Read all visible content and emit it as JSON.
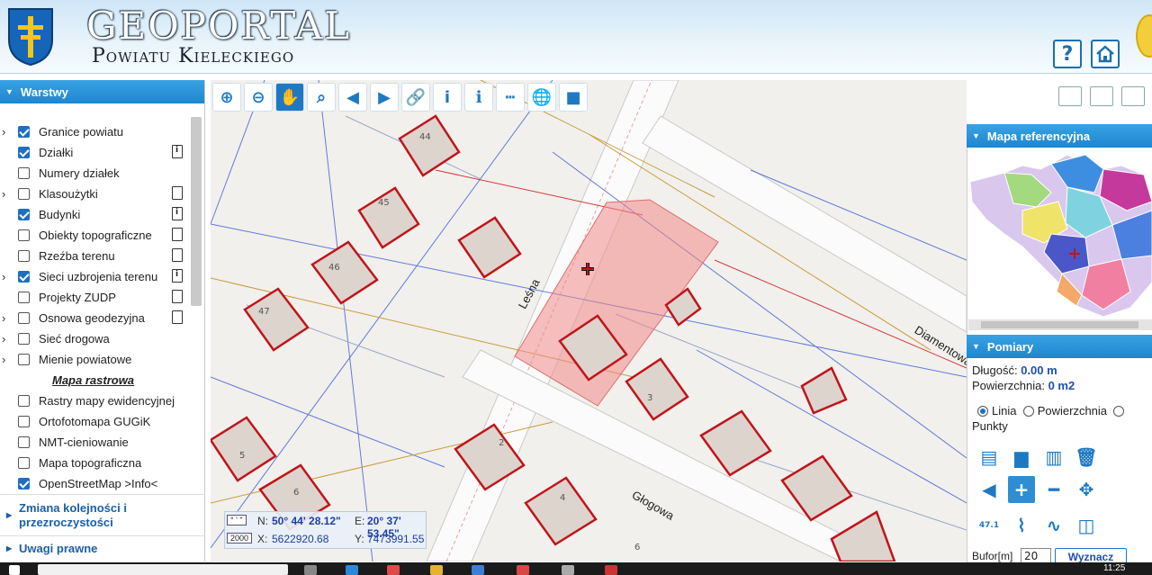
{
  "header": {
    "title": "Geoportal",
    "subtitle": "Powiatu Kieleckiego",
    "help_label": "?",
    "home_label": "⌂"
  },
  "left_panel": {
    "title": "Warstwy",
    "layers": [
      {
        "label": "Granice powiatu",
        "checked": true,
        "expandable": true,
        "doc": "none"
      },
      {
        "label": "Działki",
        "checked": true,
        "expandable": false,
        "doc": "info"
      },
      {
        "label": "Numery działek",
        "checked": false,
        "expandable": false,
        "doc": "none"
      },
      {
        "label": "Klasoużytki",
        "checked": false,
        "expandable": true,
        "doc": "plain"
      },
      {
        "label": "Budynki",
        "checked": true,
        "expandable": false,
        "doc": "info"
      },
      {
        "label": "Obiekty topograficzne",
        "checked": false,
        "expandable": false,
        "doc": "plain"
      },
      {
        "label": "Rzeźba terenu",
        "checked": false,
        "expandable": false,
        "doc": "plain"
      },
      {
        "label": "Sieci uzbrojenia terenu",
        "checked": true,
        "expandable": true,
        "doc": "info"
      },
      {
        "label": "Projekty ZUDP",
        "checked": false,
        "expandable": false,
        "doc": "plain"
      },
      {
        "label": "Osnowa geodezyjna",
        "checked": false,
        "expandable": true,
        "doc": "plain"
      },
      {
        "label": "Sieć drogowa",
        "checked": false,
        "expandable": true,
        "doc": "none"
      },
      {
        "label": "Mienie powiatowe",
        "checked": false,
        "expandable": true,
        "doc": "none"
      },
      {
        "label": "Mapa rastrowa",
        "group": true
      },
      {
        "label": "Rastry mapy ewidencyjnej",
        "checked": false,
        "expandable": false,
        "doc": "none"
      },
      {
        "label": "Ortofotomapa GUGiK",
        "checked": false,
        "expandable": false,
        "doc": "none"
      },
      {
        "label": "NMT-cieniowanie",
        "checked": false,
        "expandable": false,
        "doc": "none"
      },
      {
        "label": "Mapa topograficzna",
        "checked": false,
        "expandable": false,
        "doc": "none"
      },
      {
        "label": "OpenStreetMap >Info<",
        "checked": true,
        "expandable": false,
        "doc": "none"
      }
    ],
    "sections": {
      "order_line1": "Zmiana kolejności i",
      "order_line2": "przezroczystości",
      "legal": "Uwagi prawne"
    }
  },
  "toolbar": {
    "tools": [
      {
        "name": "zoom-in-tool",
        "glyph": "⊕",
        "active": false
      },
      {
        "name": "zoom-out-tool",
        "glyph": "⊖",
        "active": false
      },
      {
        "name": "pan-tool",
        "glyph": "✋",
        "active": true
      },
      {
        "name": "zoom-extent-tool",
        "glyph": "⌕",
        "active": false
      },
      {
        "name": "previous-view-tool",
        "glyph": "◀",
        "active": false
      },
      {
        "name": "next-view-tool",
        "glyph": "▶",
        "active": false
      },
      {
        "name": "link-tool",
        "glyph": "🔗",
        "active": false
      },
      {
        "name": "info-tool",
        "glyph": "i",
        "active": false
      },
      {
        "name": "info-advanced-tool",
        "glyph": "ℹ",
        "active": false
      },
      {
        "name": "measure-tool",
        "glyph": "┅",
        "active": false
      },
      {
        "name": "globe-tool",
        "glyph": "🌐",
        "active": false
      },
      {
        "name": "video-tool",
        "glyph": "■",
        "active": false
      }
    ]
  },
  "map": {
    "streets": [
      "Leśna",
      "Głogowa",
      "Diamentowa"
    ],
    "buildings": [
      {
        "num": "44"
      },
      {
        "num": "45"
      },
      {
        "num": "46"
      },
      {
        "num": "47"
      },
      {
        "num": "5"
      },
      {
        "num": "6"
      },
      {
        "num": "2"
      },
      {
        "num": "3"
      },
      {
        "num": "4"
      },
      {
        "num": "6"
      }
    ],
    "coords": {
      "mode_top": "° ' \"",
      "mode_bottom": "2000",
      "n_label": "N:",
      "n_value": "50° 44' 28.12\"",
      "e_label": "E:",
      "e_value": "20° 37' 53.45\"",
      "x_label": "X:",
      "x_value": "5622920.68",
      "y_label": "Y:",
      "y_value": "7473991.55"
    }
  },
  "right_panel": {
    "ref_title": "Mapa referencyjna",
    "pomiary_title": "Pomiary",
    "length_label": "Długość:",
    "length_value": "0.00 m",
    "area_label": "Powierzchnia:",
    "area_value": "0 m2",
    "opt_line": "Linia",
    "opt_area": "Powierzchnia",
    "opt_points": "Punkty",
    "selected_option": "Linia",
    "tool_label_47": "47.1",
    "bufor_label": "Bufor[m]",
    "bufor_value": "20",
    "calc_button": "Wyznacz"
  },
  "taskbar": {
    "time": "11:25"
  },
  "colors": {
    "accent": "#1f86cf",
    "building_outline": "#c0141c",
    "selection_fill": "#f08a8a"
  }
}
